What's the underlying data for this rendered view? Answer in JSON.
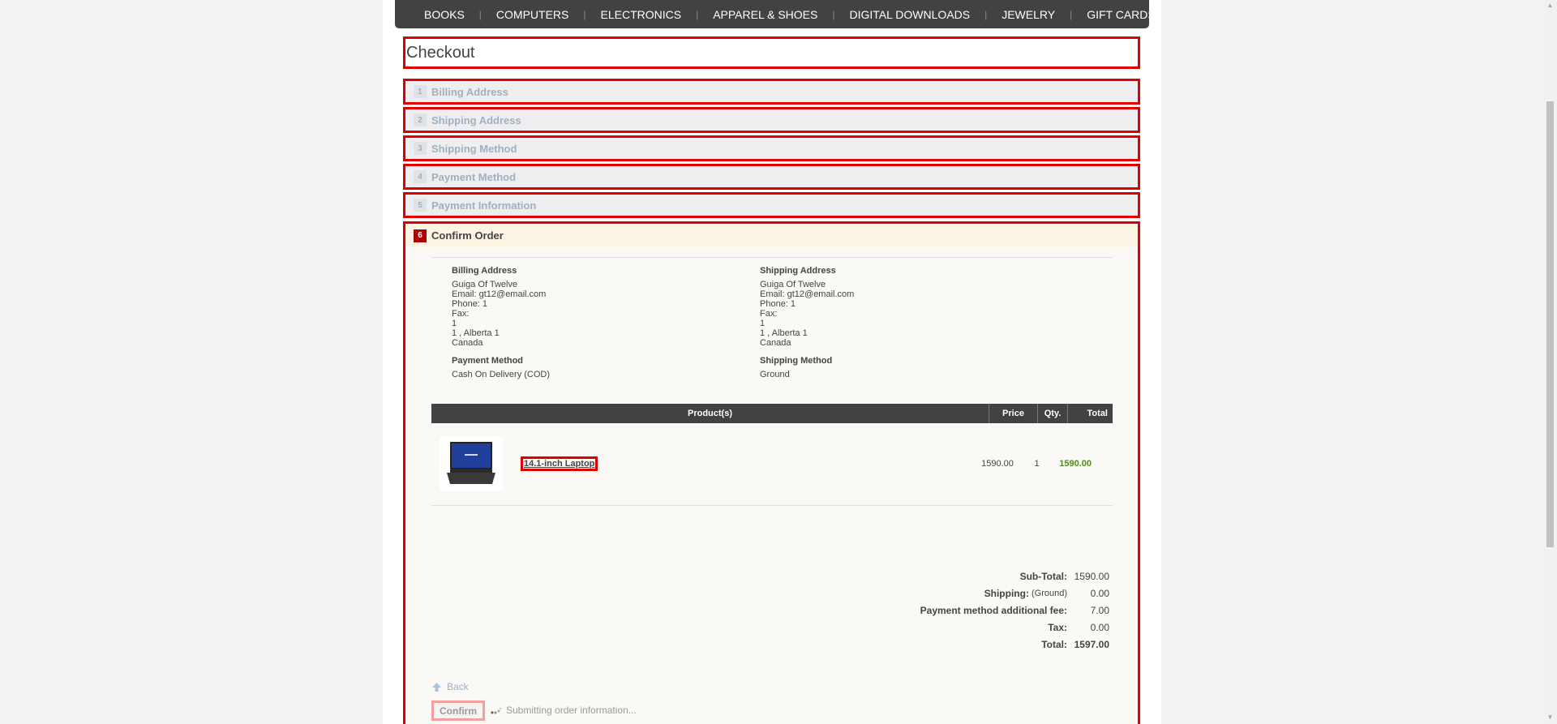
{
  "top_menu": [
    "BOOKS",
    "COMPUTERS",
    "ELECTRONICS",
    "APPAREL & SHOES",
    "DIGITAL DOWNLOADS",
    "JEWELRY",
    "GIFT CARDS"
  ],
  "page_title": "Checkout",
  "steps": [
    {
      "num": "1",
      "title": "Billing Address"
    },
    {
      "num": "2",
      "title": "Shipping Address"
    },
    {
      "num": "3",
      "title": "Shipping Method"
    },
    {
      "num": "4",
      "title": "Payment Method"
    },
    {
      "num": "5",
      "title": "Payment Information"
    },
    {
      "num": "6",
      "title": "Confirm Order"
    }
  ],
  "billing": {
    "title": "Billing Address",
    "lines": [
      "Guiga Of Twelve",
      "Email: gt12@email.com",
      "Phone: 1",
      "Fax:",
      "1",
      "1 , Alberta 1",
      "Canada"
    ]
  },
  "shipping": {
    "title": "Shipping Address",
    "lines": [
      "Guiga Of Twelve",
      "Email: gt12@email.com",
      "Phone: 1",
      "Fax:",
      "1",
      "1 , Alberta 1",
      "Canada"
    ]
  },
  "payment_method": {
    "title": "Payment Method",
    "value": "Cash On Delivery (COD)"
  },
  "shipping_method": {
    "title": "Shipping Method",
    "value": "Ground"
  },
  "cart": {
    "headers": {
      "product": "Product(s)",
      "price": "Price",
      "qty": "Qty.",
      "total": "Total"
    },
    "items": [
      {
        "name": "14.1-inch Laptop",
        "price": "1590.00",
        "qty": "1",
        "total": "1590.00"
      }
    ]
  },
  "totals": {
    "subtotal_label": "Sub-Total:",
    "subtotal": "1590.00",
    "shipping_label": "Shipping:",
    "shipping_note": "(Ground)",
    "shipping": "0.00",
    "fee_label": "Payment method additional fee:",
    "fee": "7.00",
    "tax_label": "Tax:",
    "tax": "0.00",
    "total_label": "Total:",
    "total": "1597.00"
  },
  "actions": {
    "back": "Back",
    "confirm": "Confirm",
    "submitting": "Submitting order information..."
  },
  "colors": {
    "accent_red": "#e10000",
    "step_active": "#b20000",
    "total_green": "#4d8c15",
    "menu_bg": "#424242"
  }
}
